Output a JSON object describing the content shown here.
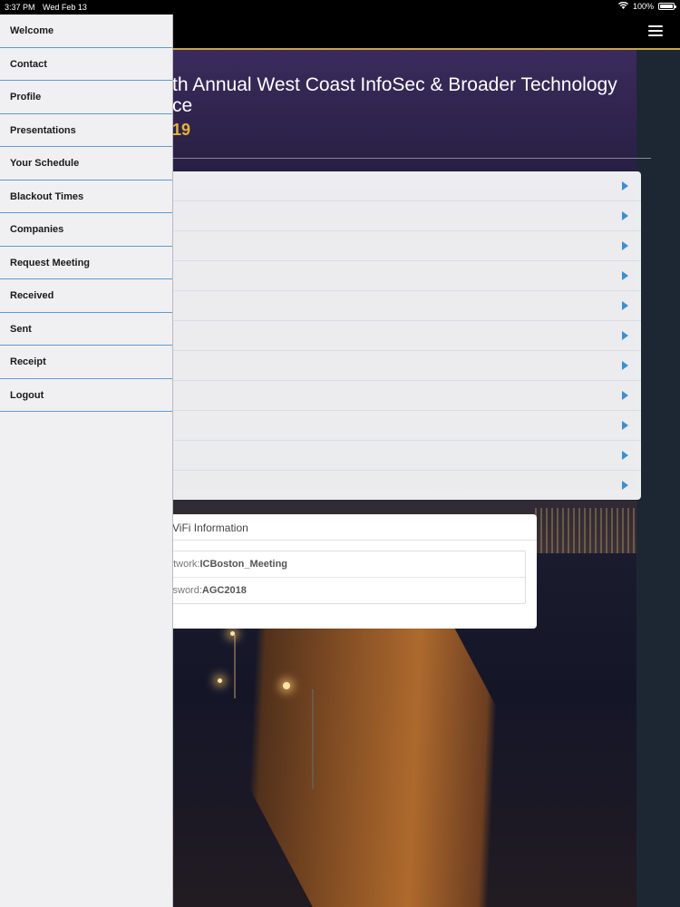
{
  "status_bar": {
    "time": "3:37 PM",
    "date": "Wed Feb 13",
    "battery": "100%"
  },
  "conference": {
    "title": "th Annual West Coast InfoSec & Broader Technology\nce",
    "date": "19"
  },
  "side_menu": {
    "items": [
      {
        "label": "Welcome"
      },
      {
        "label": "Contact"
      },
      {
        "label": "Profile"
      },
      {
        "label": "Presentations"
      },
      {
        "label": "Your Schedule"
      },
      {
        "label": "Blackout Times"
      },
      {
        "label": "Companies"
      },
      {
        "label": "Request Meeting"
      },
      {
        "label": "Received"
      },
      {
        "label": "Sent"
      },
      {
        "label": "Receipt"
      },
      {
        "label": "Logout"
      }
    ]
  },
  "list_rows": 11,
  "wifi": {
    "heading": "ViFi Information",
    "network_label": "etwork: ",
    "network_value": "ICBoston_Meeting",
    "password_label": "ssword: ",
    "password_value": "AGC2018"
  },
  "colors": {
    "accent_gold": "#e6b33a",
    "menu_divider": "#5d9bd1",
    "chevron": "#3c8fd0"
  },
  "icons": {
    "menu": "hamburger-icon",
    "wifi": "wifi-icon",
    "battery": "battery-icon",
    "row": "chevron-right-icon"
  }
}
